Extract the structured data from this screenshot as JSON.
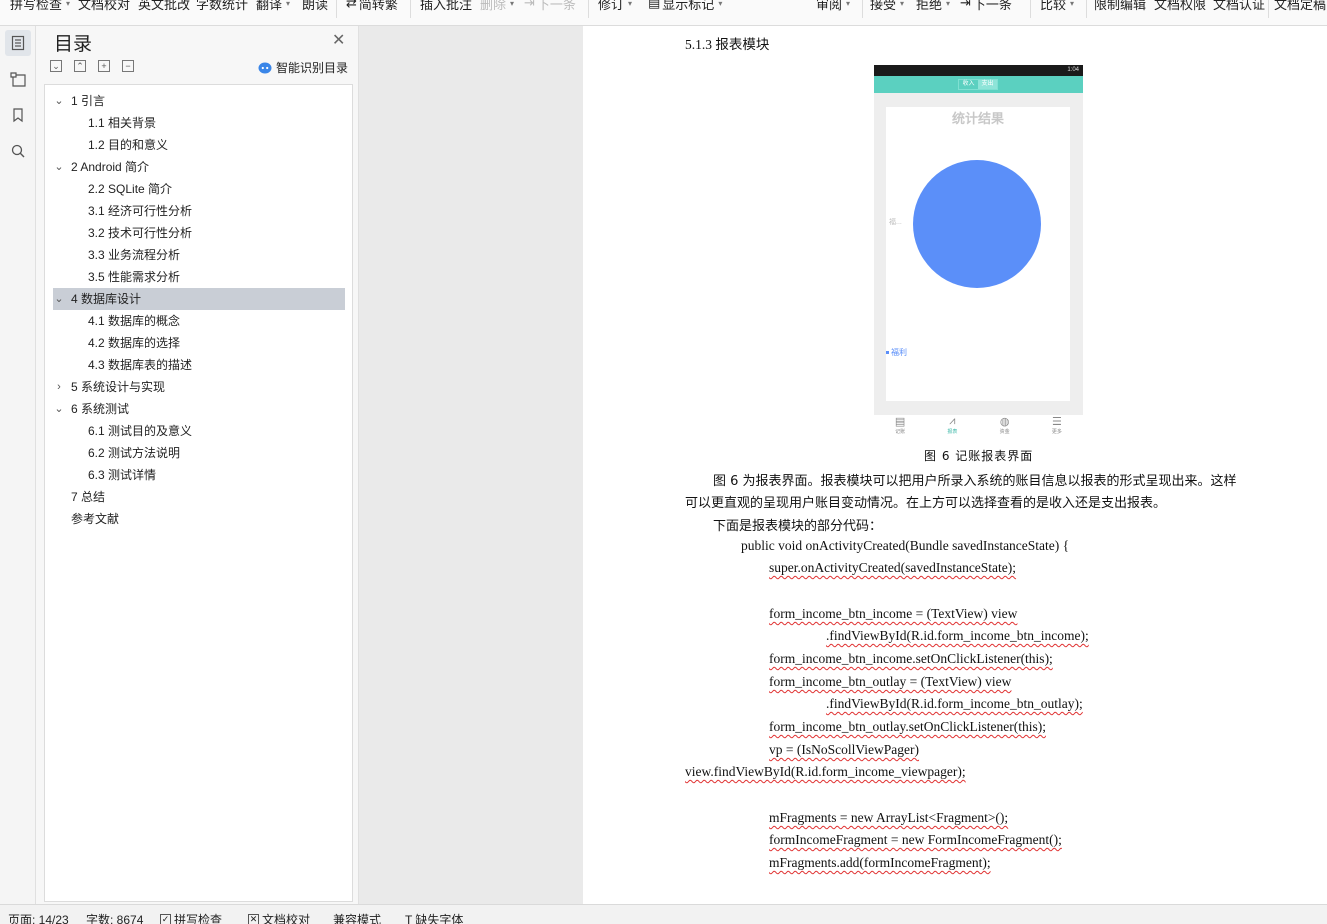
{
  "ribbon": {
    "items": [
      {
        "label": "拼写检查",
        "dropdown": true
      },
      {
        "label": "文档校对"
      },
      {
        "label": "英文批改"
      },
      {
        "label": "字数统计"
      },
      {
        "label": "翻译",
        "dropdown": true
      },
      {
        "label": "朗读"
      },
      {
        "label": "简转繁"
      },
      {
        "label": "插入批注"
      },
      {
        "label": "删除",
        "dropdown": true
      },
      {
        "label": "下一条"
      },
      {
        "label": "修订",
        "dropdown": true
      },
      {
        "label": "显示标记",
        "dropdown": true
      },
      {
        "label": "审阅",
        "dropdown": true
      },
      {
        "label": "接受",
        "dropdown": true
      },
      {
        "label": "拒绝",
        "dropdown": true
      },
      {
        "label": "下一条"
      },
      {
        "label": "比较",
        "dropdown": true
      },
      {
        "label": "限制编辑"
      },
      {
        "label": "文档权限"
      },
      {
        "label": "文档认证"
      },
      {
        "label": "文档定稿"
      }
    ]
  },
  "toc": {
    "title": "目录",
    "smart_label": "智能识别目录",
    "items": [
      {
        "label": "1 引言",
        "level": 1,
        "expanded": true
      },
      {
        "label": "1.1  相关背景",
        "level": 2
      },
      {
        "label": "1.2  目的和意义",
        "level": 2
      },
      {
        "label": "2 Android 简介",
        "level": 1,
        "expanded": true
      },
      {
        "label": "2.2 SQLite 简介",
        "level": 2
      },
      {
        "label": "3.1 经济可行性分析",
        "level": 2
      },
      {
        "label": "3.2 技术可行性分析",
        "level": 2
      },
      {
        "label": "3.3 业务流程分析",
        "level": 2
      },
      {
        "label": "3.5 性能需求分析",
        "level": 2
      },
      {
        "label": "4  数据库设计",
        "level": 1,
        "expanded": true,
        "selected": true
      },
      {
        "label": "4.1  数据库的概念",
        "level": 2
      },
      {
        "label": "4.2  数据库的选择",
        "level": 2
      },
      {
        "label": "4.3  数据库表的描述",
        "level": 2
      },
      {
        "label": "5 系统设计与实现",
        "level": 1,
        "expanded": false
      },
      {
        "label": "6 系统测试",
        "level": 1,
        "expanded": true
      },
      {
        "label": "6.1 测试目的及意义",
        "level": 2
      },
      {
        "label": "6.2 测试方法说明",
        "level": 2
      },
      {
        "label": "6.3 测试详情",
        "level": 2
      },
      {
        "label": "7 总结",
        "level": 1
      },
      {
        "label": "参考文献",
        "level": 1
      }
    ]
  },
  "doc": {
    "section_heading": "5.1.3  报表模块",
    "figure_caption": "图 6  记账报表界面",
    "para1_line1": "图 6 为报表界面。报表模块可以把用户所录入系统的账目信息以报表的形式呈现出来。这样",
    "para1_line2": "可以更直观的呈现用户账目变动情况。在上方可以选择查看的是收入还是支出报表。",
    "para2": "下面是报表模块的部分代码：",
    "code": [
      "public void onActivityCreated(Bundle savedInstanceState) {",
      "super.onActivityCreated(savedInstanceState);",
      "form_income_btn_income = (TextView) view",
      ".findViewById(R.id.form_income_btn_income);",
      "form_income_btn_income.setOnClickListener(this);",
      "form_income_btn_outlay = (TextView) view",
      ".findViewById(R.id.form_income_btn_outlay);",
      "form_income_btn_outlay.setOnClickListener(this);",
      "vp = (IsNoScollViewPager)",
      "view.findViewById(R.id.form_income_viewpager);",
      "mFragments = new ArrayList<Fragment>();",
      "formIncomeFragment = new FormIncomeFragment();",
      "mFragments.add(formIncomeFragment);"
    ],
    "phone": {
      "status_time": "1:04",
      "tab_income": "收入",
      "tab_outlay": "支出",
      "chart_title": "统计结果",
      "slice_label": "福...",
      "legend_label": "福利",
      "slice_color": "#5b8ff9",
      "nav": [
        "记账",
        "报表",
        "资金",
        "更多"
      ]
    }
  },
  "status": {
    "page": "页面: 14/23",
    "words": "字数: 8674",
    "spell": "拼写检查",
    "proof": "文档校对",
    "compat": "兼容模式",
    "missing_font": "缺失字体"
  }
}
